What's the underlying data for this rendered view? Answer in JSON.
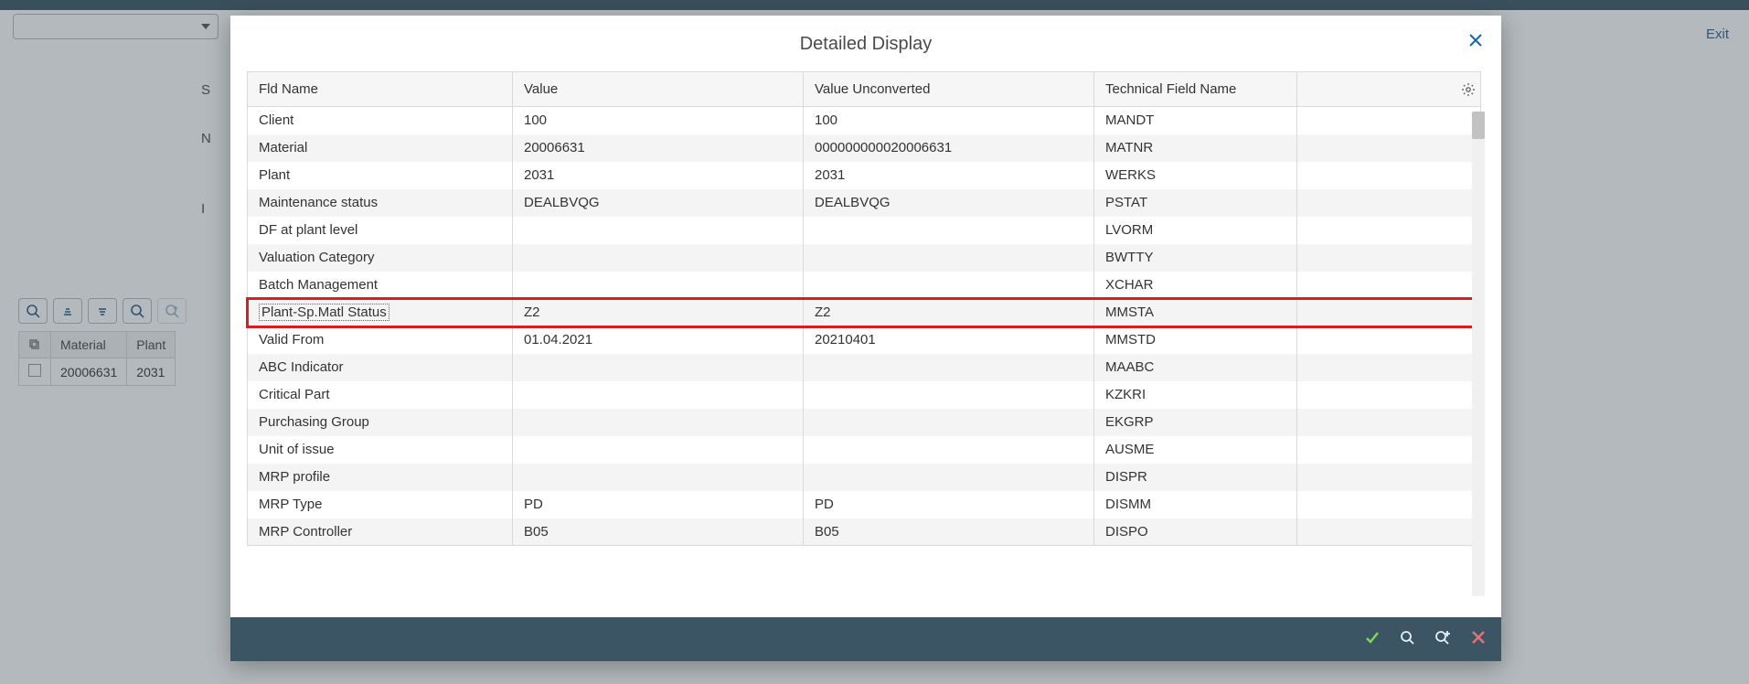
{
  "header": {
    "exit": "Exit"
  },
  "left_labels": {
    "s": "S",
    "n": "N",
    "i": "I"
  },
  "bg_table": {
    "headers": {
      "material": "Material",
      "plant": "Plant"
    },
    "rows": [
      {
        "material": "20006631",
        "plant": "2031"
      }
    ]
  },
  "modal": {
    "title": "Detailed Display",
    "columns": {
      "fld_name": "Fld Name",
      "value": "Value",
      "value_unconv": "Value Unconverted",
      "tech": "Technical Field Name"
    },
    "rows": [
      {
        "fld": "Client",
        "val": "100",
        "unc": "100",
        "tech": "MANDT"
      },
      {
        "fld": "Material",
        "val": "20006631",
        "unc": "000000000020006631",
        "tech": "MATNR"
      },
      {
        "fld": "Plant",
        "val": "2031",
        "unc": "2031",
        "tech": "WERKS"
      },
      {
        "fld": "Maintenance status",
        "val": "DEALBVQG",
        "unc": "DEALBVQG",
        "tech": "PSTAT"
      },
      {
        "fld": "DF at plant level",
        "val": "",
        "unc": "",
        "tech": "LVORM"
      },
      {
        "fld": "Valuation Category",
        "val": "",
        "unc": "",
        "tech": "BWTTY"
      },
      {
        "fld": "Batch Management",
        "val": "",
        "unc": "",
        "tech": "XCHAR"
      },
      {
        "fld": "Plant-Sp.Matl Status",
        "val": "Z2",
        "unc": "Z2",
        "tech": "MMSTA",
        "highlight": true
      },
      {
        "fld": "Valid From",
        "val": "01.04.2021",
        "unc": "20210401",
        "tech": "MMSTD"
      },
      {
        "fld": "ABC Indicator",
        "val": "",
        "unc": "",
        "tech": "MAABC"
      },
      {
        "fld": "Critical Part",
        "val": "",
        "unc": "",
        "tech": "KZKRI"
      },
      {
        "fld": "Purchasing Group",
        "val": "",
        "unc": "",
        "tech": "EKGRP"
      },
      {
        "fld": "Unit of issue",
        "val": "",
        "unc": "",
        "tech": "AUSME"
      },
      {
        "fld": "MRP profile",
        "val": "",
        "unc": "",
        "tech": "DISPR"
      },
      {
        "fld": "MRP Type",
        "val": "PD",
        "unc": "PD",
        "tech": "DISMM"
      },
      {
        "fld": "MRP Controller",
        "val": "B05",
        "unc": "B05",
        "tech": "DISPO"
      }
    ]
  }
}
